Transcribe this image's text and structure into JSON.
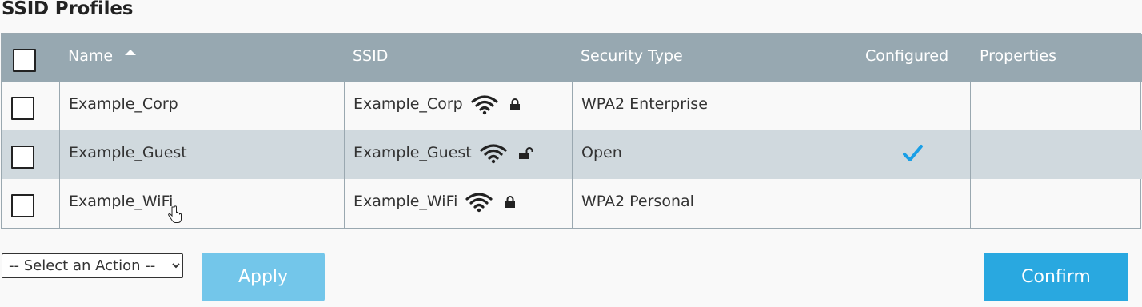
{
  "page": {
    "title": "SSID Profiles"
  },
  "table": {
    "columns": [
      "Name",
      "SSID",
      "Security Type",
      "Configured",
      "Properties"
    ],
    "sort": {
      "column": "Name",
      "direction": "ascending"
    },
    "rows": [
      {
        "name": "Example_Corp",
        "ssid": "Example_Corp",
        "locked": true,
        "security": "WPA2 Enterprise",
        "configured": false,
        "properties": ""
      },
      {
        "name": "Example_Guest",
        "ssid": "Example_Guest",
        "locked": false,
        "security": "Open",
        "configured": true,
        "properties": ""
      },
      {
        "name": "Example_WiFi",
        "ssid": "Example_WiFi",
        "locked": true,
        "security": "WPA2 Personal",
        "configured": false,
        "properties": ""
      }
    ]
  },
  "actions": {
    "select_value": "-- Select an Action --",
    "apply_label": "Apply",
    "confirm_label": "Confirm"
  },
  "colors": {
    "header_bg": "#97a8b1",
    "alt_row_bg": "#d0d9de",
    "check_blue": "#1a9fe6",
    "apply_bg": "#73c6ea",
    "confirm_bg": "#29a8e0"
  },
  "icons": {
    "sort": "sort-ascending-icon",
    "signal": "wifi-signal-icon",
    "secure": "lock-closed-icon",
    "open": "lock-open-icon",
    "configured": "checkmark-icon"
  }
}
